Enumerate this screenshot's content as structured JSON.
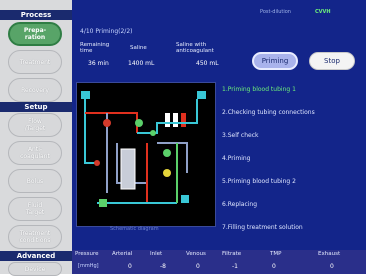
{
  "header": {
    "status": "Post-dilution",
    "mode": "CVVH",
    "screen_title": "4/10 Priming(2/2)"
  },
  "sidebar": {
    "section_process": "Process",
    "section_setup": "Setup",
    "section_advanced": "Advanced",
    "process_items": [
      {
        "label": "Prepa-\nration",
        "active": true
      },
      {
        "label": "Treatment",
        "active": false
      },
      {
        "label": "Recovery",
        "active": false
      }
    ],
    "setup_items": [
      {
        "label": "Flow\n/Target"
      },
      {
        "label": "Anti-\ncoagulant"
      },
      {
        "label": "Bolus"
      },
      {
        "label": "Fluid\nTarget"
      },
      {
        "label": "Treatment\nconditions"
      }
    ],
    "advanced_items": [
      {
        "label": "Device"
      }
    ]
  },
  "info": {
    "remaining_time_label": "Remaining\ntime",
    "remaining_time_value": "36 min",
    "saline_label": "Saline",
    "saline_value": "1400 mL",
    "saline_anticoag_label": "Saline with\nanticoagulant",
    "saline_anticoag_value": "450 mL"
  },
  "buttons": {
    "priming": "Priming",
    "stop": "Stop"
  },
  "steps": [
    {
      "label": "1.Priming blood tubing 1",
      "current": true
    },
    {
      "label": "2.Checking tubing connections",
      "current": false
    },
    {
      "label": "3.Self check",
      "current": false
    },
    {
      "label": "4.Priming",
      "current": false
    },
    {
      "label": "5.Priming blood tubing 2",
      "current": false
    },
    {
      "label": "6.Replacing",
      "current": false
    },
    {
      "label": "7.Filling treatment solution",
      "current": false
    }
  ],
  "diagram": {
    "caption": "Schematic diagram"
  },
  "pressure": {
    "title": "Pressure",
    "unit": "[mmHg]",
    "columns": [
      {
        "label": "Arterial",
        "value": "0"
      },
      {
        "label": "Inlet",
        "value": "-8"
      },
      {
        "label": "Venous",
        "value": "0"
      },
      {
        "label": "Filtrate",
        "value": "-1"
      },
      {
        "label": "TMP",
        "value": "0"
      },
      {
        "label": "Exhaust",
        "value": "0"
      }
    ]
  },
  "colors": {
    "panel_bg": "#13258a",
    "accent_green": "#58a468",
    "current_step": "#6df07a"
  }
}
